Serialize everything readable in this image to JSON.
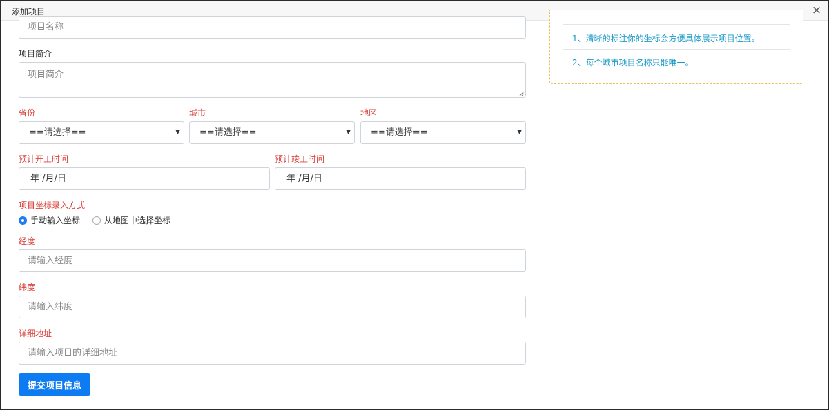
{
  "header": {
    "title": "添加项目",
    "close_symbol": "×"
  },
  "form": {
    "project_name": {
      "placeholder": "项目名称"
    },
    "project_intro": {
      "label": "项目简介",
      "placeholder": "项目简介"
    },
    "province": {
      "label": "省份",
      "selected": "==请选择=="
    },
    "city": {
      "label": "城市",
      "selected": "==请选择=="
    },
    "district": {
      "label": "地区",
      "selected": "==请选择=="
    },
    "start_date": {
      "label": "预计开工时间",
      "value": "年 /月/日"
    },
    "end_date": {
      "label": "预计竣工时间",
      "value": "年 /月/日"
    },
    "coord_mode": {
      "label": "项目坐标录入方式",
      "options": [
        {
          "label": "手动输入坐标",
          "checked": true
        },
        {
          "label": "从地图中选择坐标",
          "checked": false
        }
      ]
    },
    "longitude": {
      "label": "经度",
      "placeholder": "请输入经度"
    },
    "latitude": {
      "label": "纬度",
      "placeholder": "请输入纬度"
    },
    "address": {
      "label": "详细地址",
      "placeholder": "请输入项目的详细地址"
    },
    "submit_label": "提交项目信息"
  },
  "tips": {
    "items": [
      "1、清晰的标注你的坐标会方便具体展示项目位置。",
      "2、每个城市项目名称只能唯一。"
    ]
  },
  "colors": {
    "required_label": "#d9433e",
    "primary_button": "#0d7cf2",
    "tips_text": "#1a9bc8",
    "tips_border": "#e8c15a"
  },
  "icons": {
    "close": "close-icon",
    "select_caret": "caret-down-icon",
    "resize": "resize-grip-icon"
  }
}
